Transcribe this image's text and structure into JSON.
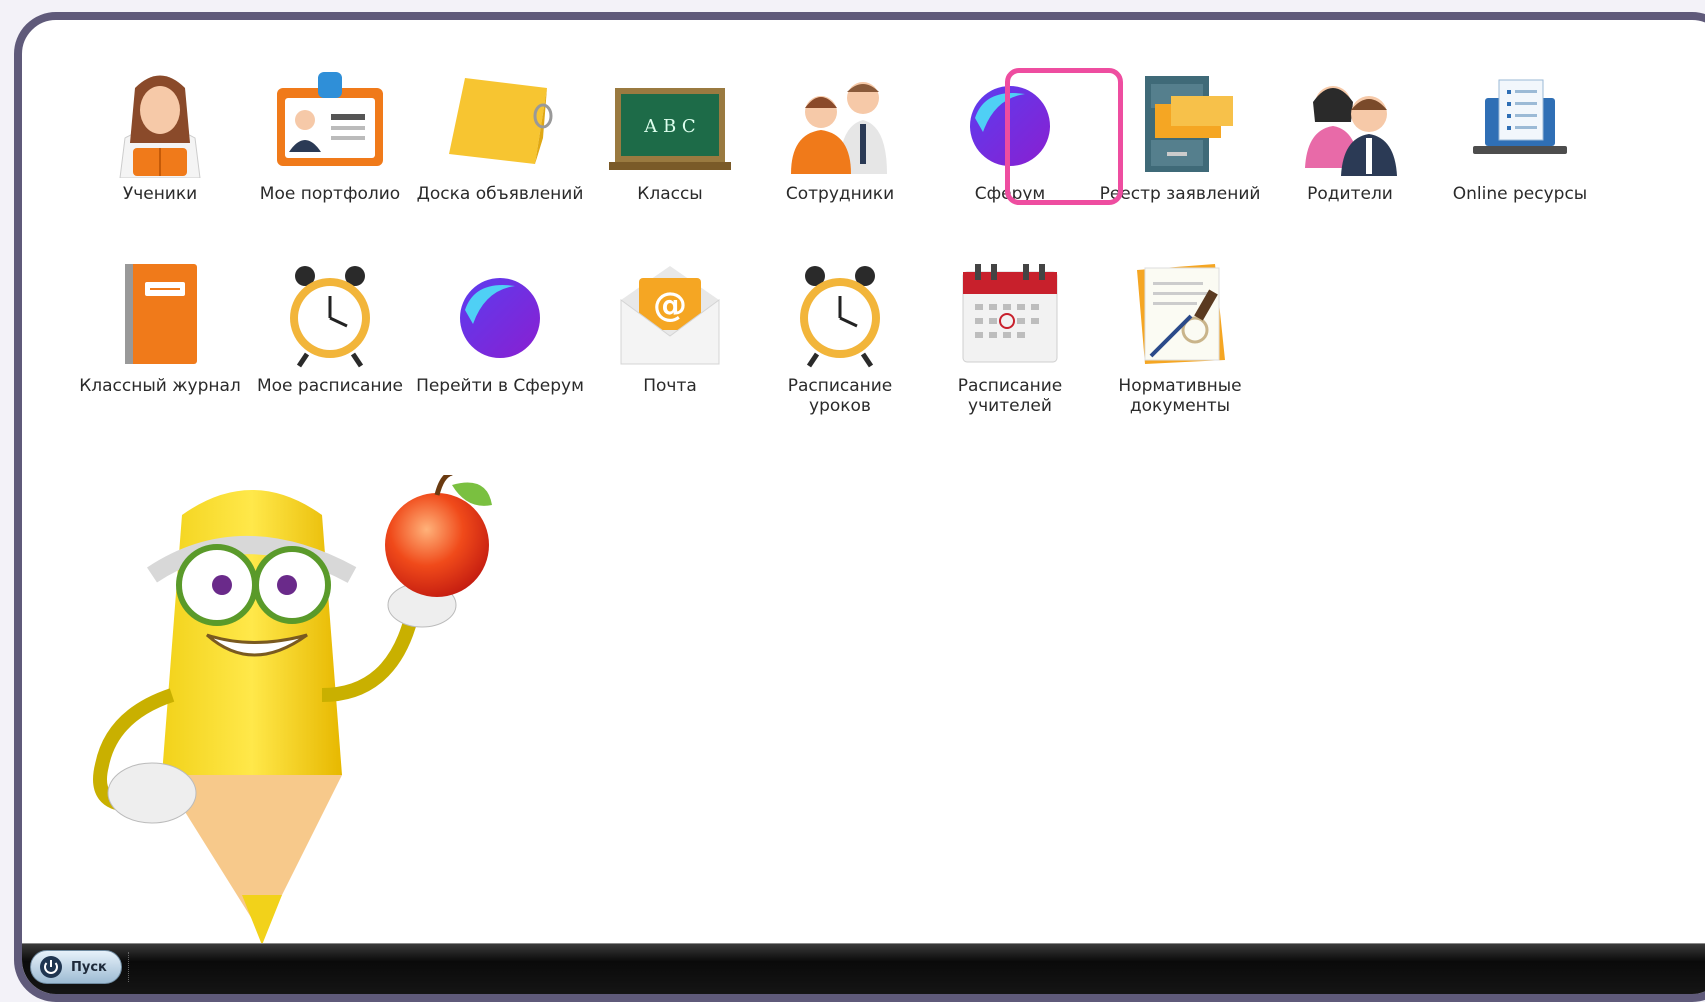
{
  "desktop": {
    "icons": [
      {
        "label": "Ученики",
        "icon": "student-icon"
      },
      {
        "label": "Мое портфолио",
        "icon": "portfolio-icon"
      },
      {
        "label": "Доска объявлений",
        "icon": "notice-board-icon"
      },
      {
        "label": "Классы",
        "icon": "chalkboard-icon"
      },
      {
        "label": "Сотрудники",
        "icon": "staff-icon"
      },
      {
        "label": "Сферум",
        "icon": "sferum-icon",
        "selected": true
      },
      {
        "label": "Реестр заявлений",
        "icon": "file-cabinet-icon"
      },
      {
        "label": "Родители",
        "icon": "parents-icon"
      },
      {
        "label": "Online ресурсы",
        "icon": "laptop-checklist-icon"
      },
      {
        "label": "Классный журнал",
        "icon": "notebook-icon"
      },
      {
        "label": "Мое расписание",
        "icon": "alarm-clock-icon"
      },
      {
        "label": "Перейти в Сферум",
        "icon": "sferum-icon"
      },
      {
        "label": "Почта",
        "icon": "mail-icon"
      },
      {
        "label": "Расписание уроков",
        "icon": "alarm-clock-icon"
      },
      {
        "label": "Расписание учителей",
        "icon": "calendar-icon"
      },
      {
        "label": "Нормативные документы",
        "icon": "documents-stamp-icon"
      }
    ],
    "highlight_color": "#ee4da0"
  },
  "taskbar": {
    "start_label": "Пуск"
  }
}
